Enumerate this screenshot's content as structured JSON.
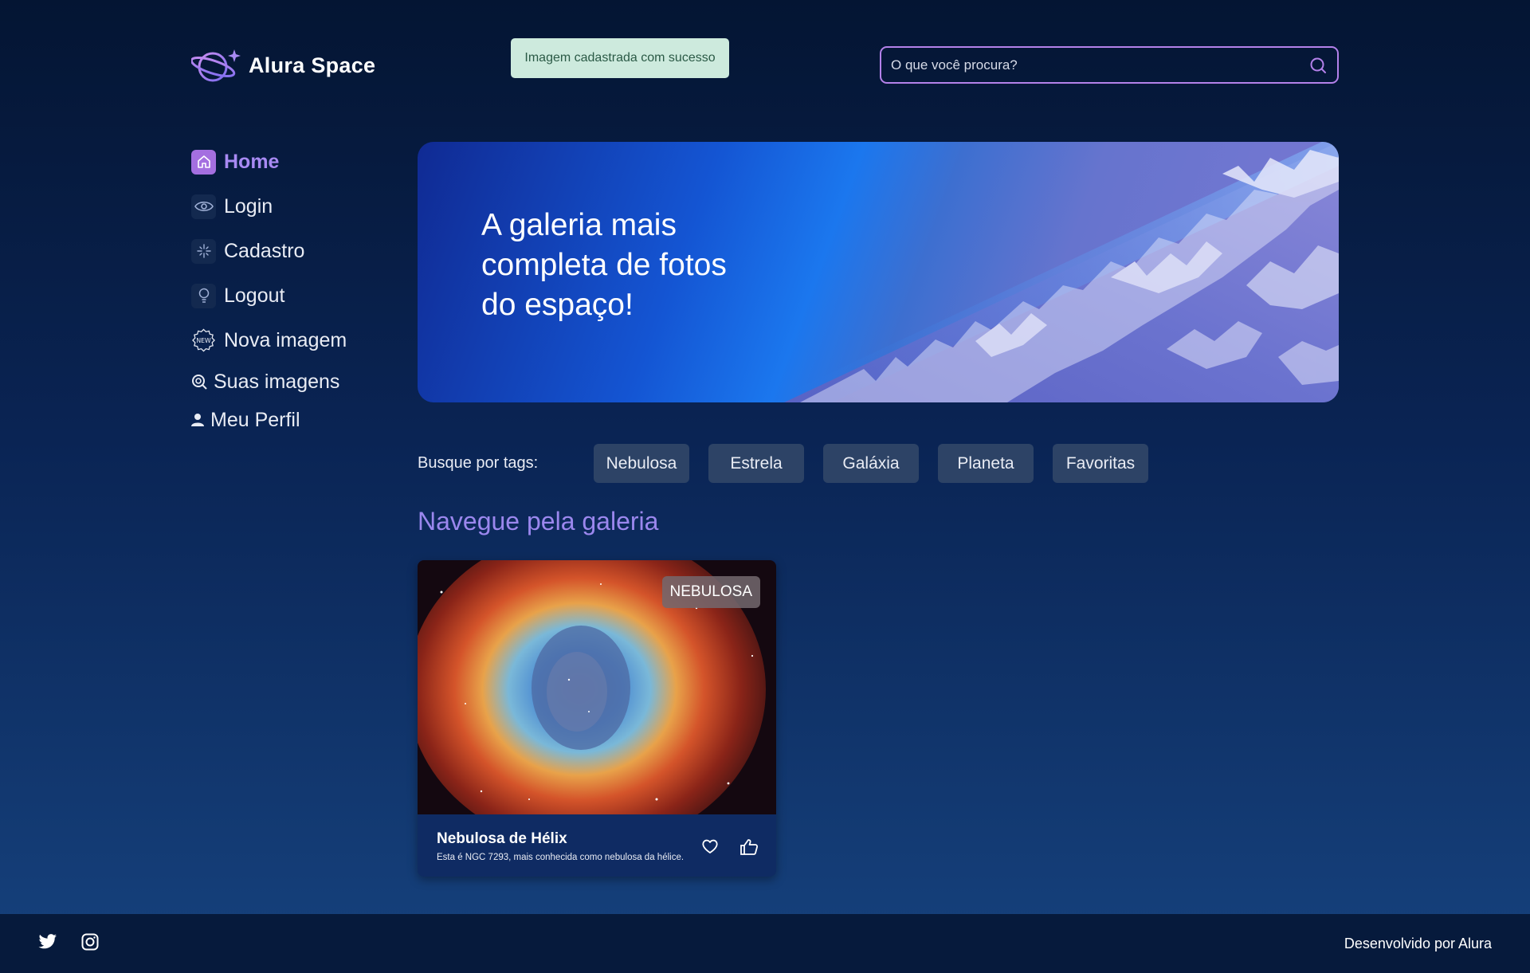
{
  "brand": {
    "name": "Alura Space",
    "icon": "planet-logo-icon"
  },
  "toast": {
    "message": "Imagem cadastrada com sucesso"
  },
  "search": {
    "placeholder": "O que você procura?",
    "icon": "search-icon"
  },
  "sidebar": {
    "items": [
      {
        "label": "Home",
        "icon": "home-icon",
        "active": true
      },
      {
        "label": "Login",
        "icon": "eye-icon"
      },
      {
        "label": "Cadastro",
        "icon": "sparkle-icon"
      },
      {
        "label": "Logout",
        "icon": "lightbulb-icon"
      },
      {
        "label": "Nova imagem",
        "icon": "new-badge-icon"
      },
      {
        "label": "Suas imagens",
        "icon": "image-search-icon"
      },
      {
        "label": "Meu Perfil",
        "icon": "user-icon"
      }
    ]
  },
  "banner": {
    "headline": "A galeria mais completa de fotos do espaço!"
  },
  "tags": {
    "label": "Busque por tags:",
    "items": [
      "Nebulosa",
      "Estrela",
      "Galáxia",
      "Planeta",
      "Favoritas"
    ]
  },
  "gallery": {
    "title": "Navegue pela galeria",
    "cards": [
      {
        "tag": "NEBULOSA",
        "title": "Nebulosa de Hélix",
        "description": "Esta é NGC 7293, mais conhecida como nebulosa da hélice."
      }
    ]
  },
  "footer": {
    "credit": "Desenvolvido por Alura"
  },
  "colors": {
    "accent": "#a88af3",
    "search_border": "#b481ea",
    "toast_bg": "#cdeadd",
    "tag_bg": "#2d4366"
  }
}
